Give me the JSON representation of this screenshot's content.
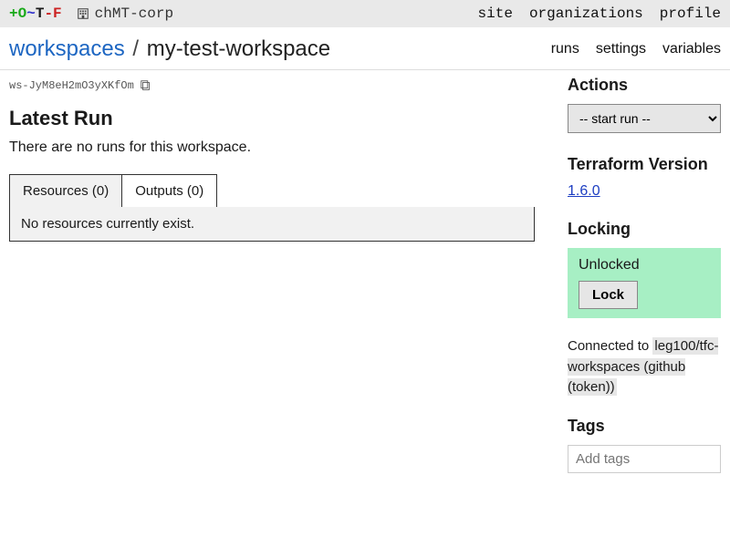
{
  "topbar": {
    "brand": {
      "plus": "+",
      "o": "O",
      "tilde": "~",
      "t": "T",
      "dash": "-",
      "f": "F"
    },
    "org": "chMT-corp",
    "nav": {
      "site": "site",
      "organizations": "organizations",
      "profile": "profile"
    }
  },
  "header": {
    "breadcrumb_root": "workspaces",
    "breadcrumb_sep": "/",
    "workspace_name": "my-test-workspace",
    "subnav": {
      "runs": "runs",
      "settings": "settings",
      "variables": "variables"
    }
  },
  "workspace": {
    "id": "ws-JyM8eH2mO3yXKfOm"
  },
  "latest_run": {
    "heading": "Latest Run",
    "empty_message": "There are no runs for this workspace."
  },
  "tabs": {
    "resources_label": "Resources (0)",
    "outputs_label": "Outputs (0)",
    "resources_empty": "No resources currently exist."
  },
  "sidebar": {
    "actions_h": "Actions",
    "start_run_placeholder": "-- start run --",
    "tf_version_h": "Terraform Version",
    "tf_version": "1.6.0",
    "locking_h": "Locking",
    "lock_status": "Unlocked",
    "lock_button": "Lock",
    "vcs_prefix": "Connected to ",
    "vcs_repo": "leg100/tfc-workspaces (github (token))",
    "tags_h": "Tags",
    "tags_placeholder": "Add tags"
  }
}
